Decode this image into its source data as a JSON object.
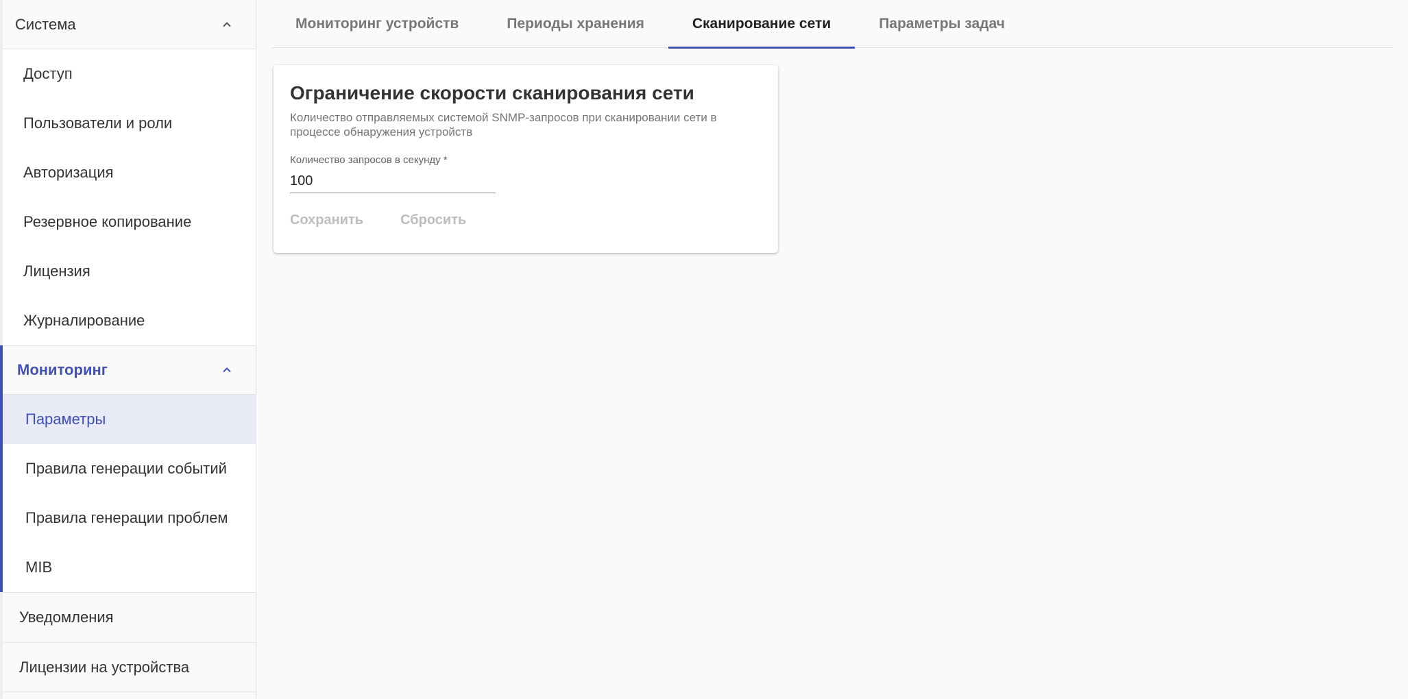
{
  "sidebar": {
    "system": {
      "label": "Система",
      "items": [
        {
          "label": "Доступ"
        },
        {
          "label": "Пользователи и роли"
        },
        {
          "label": "Авторизация"
        },
        {
          "label": "Резервное копирование"
        },
        {
          "label": "Лицензия"
        },
        {
          "label": "Журналирование"
        }
      ]
    },
    "monitoring": {
      "label": "Мониторинг",
      "items": [
        {
          "label": "Параметры",
          "active": true
        },
        {
          "label": "Правила генерации событий"
        },
        {
          "label": "Правила генерации проблем"
        },
        {
          "label": "MIB"
        }
      ]
    },
    "notifications": {
      "label": "Уведомления"
    },
    "device_licenses": {
      "label": "Лицензии на устройства"
    }
  },
  "tabs": [
    {
      "label": "Мониторинг устройств"
    },
    {
      "label": "Периоды хранения"
    },
    {
      "label": "Сканирование сети",
      "active": true
    },
    {
      "label": "Параметры задач"
    }
  ],
  "card": {
    "title": "Ограничение скорости сканирования сети",
    "description": "Количество отправляемых системой SNMP-запросов при сканировании сети в процессе обнаружения устройств",
    "field_label": "Количество запросов в секунду *",
    "field_value": "100",
    "save_label": "Сохранить",
    "reset_label": "Сбросить"
  },
  "colors": {
    "accent": "#3f51b5",
    "active_bg": "#e8eaf6",
    "disabled_text": "#bdbdbd"
  }
}
